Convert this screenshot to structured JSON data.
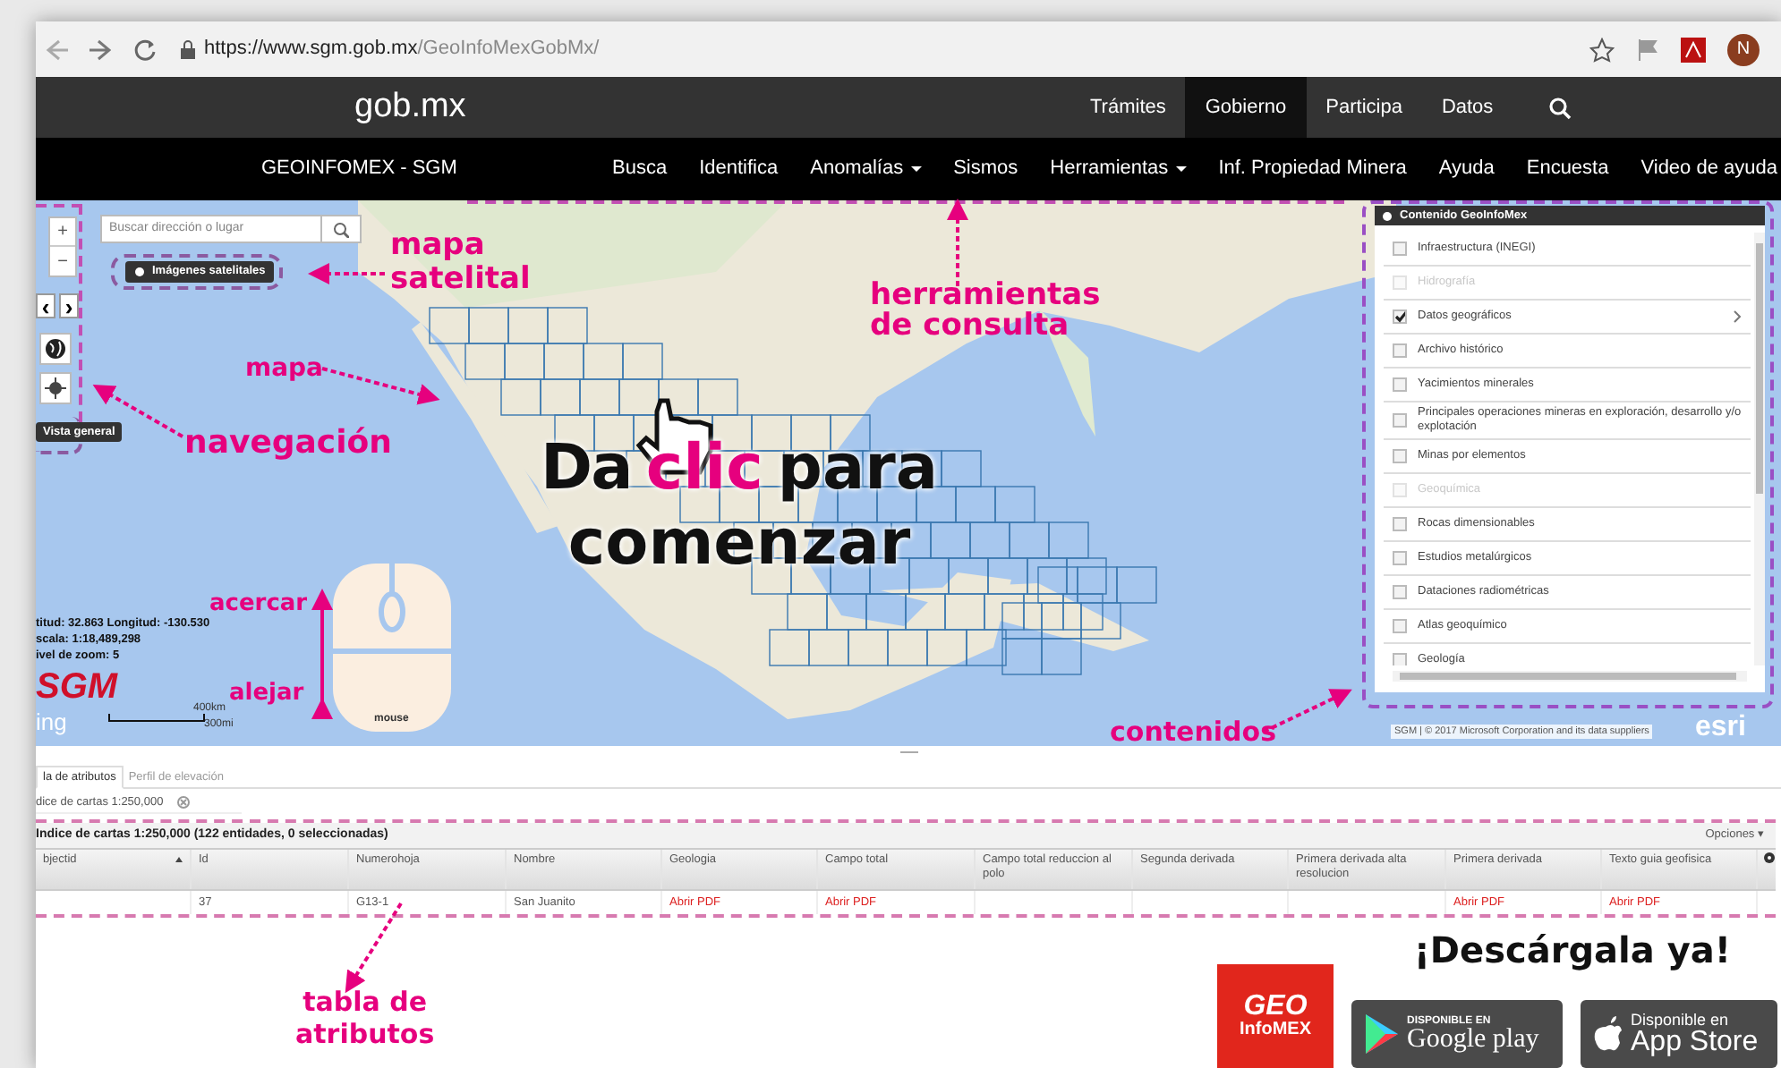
{
  "browser": {
    "url_host": "https://www.sgm.gob.mx",
    "url_path": "/GeoInfoMexGobMx/",
    "avatar": "N"
  },
  "gob_header": {
    "logo": "gob.mx",
    "links": [
      {
        "label": "Trámites",
        "selected": false
      },
      {
        "label": "Gobierno",
        "selected": true
      },
      {
        "label": "Participa",
        "selected": false
      },
      {
        "label": "Datos",
        "selected": false
      }
    ]
  },
  "app_nav": {
    "title": "GEOINFOMEX - SGM",
    "items": [
      {
        "label": "Busca",
        "dropdown": false
      },
      {
        "label": "Identifica",
        "dropdown": false
      },
      {
        "label": "Anomalías",
        "dropdown": true
      },
      {
        "label": "Sismos",
        "dropdown": false
      },
      {
        "label": "Herramientas",
        "dropdown": true
      },
      {
        "label": "Inf. Propiedad Minera",
        "dropdown": false
      },
      {
        "label": "Ayuda",
        "dropdown": false
      },
      {
        "label": "Encuesta",
        "dropdown": false
      },
      {
        "label": "Video de ayuda",
        "dropdown": false
      }
    ]
  },
  "map": {
    "search_placeholder": "Buscar dirección o lugar",
    "zoom_in": "+",
    "zoom_out": "−",
    "satellite_button": "Imágenes satelitales",
    "previous_extent": "‹",
    "next_extent": "›",
    "overview_button": "Vista general",
    "coordinates": [
      "titud: 32.863 Longitud: -130.530",
      "scala: 1:18,489,298",
      "ivel de zoom: 5"
    ],
    "logo": "SGM",
    "bing": "ing",
    "scale": [
      "400km",
      "300mi"
    ],
    "attribution": "SGM | © 2017 Microsoft Corporation and its data suppliers",
    "esri": "esri",
    "mouse_label": "mouse"
  },
  "layers_panel": {
    "title": "Contenido GeoInfoMex",
    "items": [
      {
        "label": "Infraestructura (INEGI)",
        "checked": false,
        "disabled": false,
        "submenu": false
      },
      {
        "label": "Hidrografía",
        "checked": false,
        "disabled": true,
        "submenu": false
      },
      {
        "label": "Datos geográficos",
        "checked": true,
        "disabled": false,
        "submenu": true
      },
      {
        "label": "Archivo histórico",
        "checked": false,
        "disabled": false,
        "submenu": false
      },
      {
        "label": "Yacimientos minerales",
        "checked": false,
        "disabled": false,
        "submenu": false
      },
      {
        "label": "Principales operaciones mineras en exploración, desarrollo y/o explotación",
        "checked": false,
        "disabled": false,
        "submenu": false
      },
      {
        "label": "Minas por elementos",
        "checked": false,
        "disabled": false,
        "submenu": false
      },
      {
        "label": "Geoquímica",
        "checked": false,
        "disabled": true,
        "submenu": false
      },
      {
        "label": "Rocas dimensionables",
        "checked": false,
        "disabled": false,
        "submenu": false
      },
      {
        "label": "Estudios metalúrgicos",
        "checked": false,
        "disabled": false,
        "submenu": false
      },
      {
        "label": "Dataciones radiométricas",
        "checked": false,
        "disabled": false,
        "submenu": false
      },
      {
        "label": "Atlas geoquímico",
        "checked": false,
        "disabled": false,
        "submenu": false
      },
      {
        "label": "Geología",
        "checked": false,
        "disabled": false,
        "submenu": false
      }
    ]
  },
  "call_to_action": {
    "before": "Da",
    "highlight": "clic",
    "after": "para",
    "line2": "comenzar"
  },
  "annotations": [
    "mapa\nsatelital",
    "herramientas\nde consulta",
    "mapa",
    "navegación",
    "acercar",
    "alejar",
    "contenidos",
    "tabla de\natributos"
  ],
  "attribute_table": {
    "tabs": [
      {
        "label": "la de atributos",
        "selected": true
      },
      {
        "label": "Perfil de elevación",
        "selected": false
      }
    ],
    "layer_tab": "dice de cartas 1:250,000",
    "caption": "Indice de cartas 1:250,000 (122 entidades, 0 seleccionadas)",
    "options": "Opciones ▾",
    "columns": [
      "bjectid",
      "Id",
      "Numerohoja",
      "Nombre",
      "Geologia",
      "Campo total",
      "Campo total reduccion al polo",
      "Segunda derivada",
      "Primera derivada alta resolucion",
      "Primera derivada",
      "Texto guia geofisica"
    ],
    "rows": [
      [
        {
          "text": "",
          "kind": "text"
        },
        {
          "text": "37",
          "kind": "text"
        },
        {
          "text": "G13-1",
          "kind": "text"
        },
        {
          "text": "San Juanito",
          "kind": "text"
        },
        {
          "text": "Abrir PDF",
          "kind": "link"
        },
        {
          "text": "Abrir PDF",
          "kind": "link"
        },
        {
          "text": "",
          "kind": "text"
        },
        {
          "text": "",
          "kind": "text"
        },
        {
          "text": "",
          "kind": "text"
        },
        {
          "text": "Abrir PDF",
          "kind": "link"
        },
        {
          "text": "Abrir PDF",
          "kind": "link"
        }
      ]
    ]
  },
  "download": {
    "heading": "¡Descárgala ya!",
    "app_logo": [
      "GEO",
      "InfoMEX"
    ],
    "google_play": [
      "DISPONIBLE EN",
      "Google play"
    ],
    "app_store": [
      "Disponible en",
      "App Store"
    ]
  }
}
